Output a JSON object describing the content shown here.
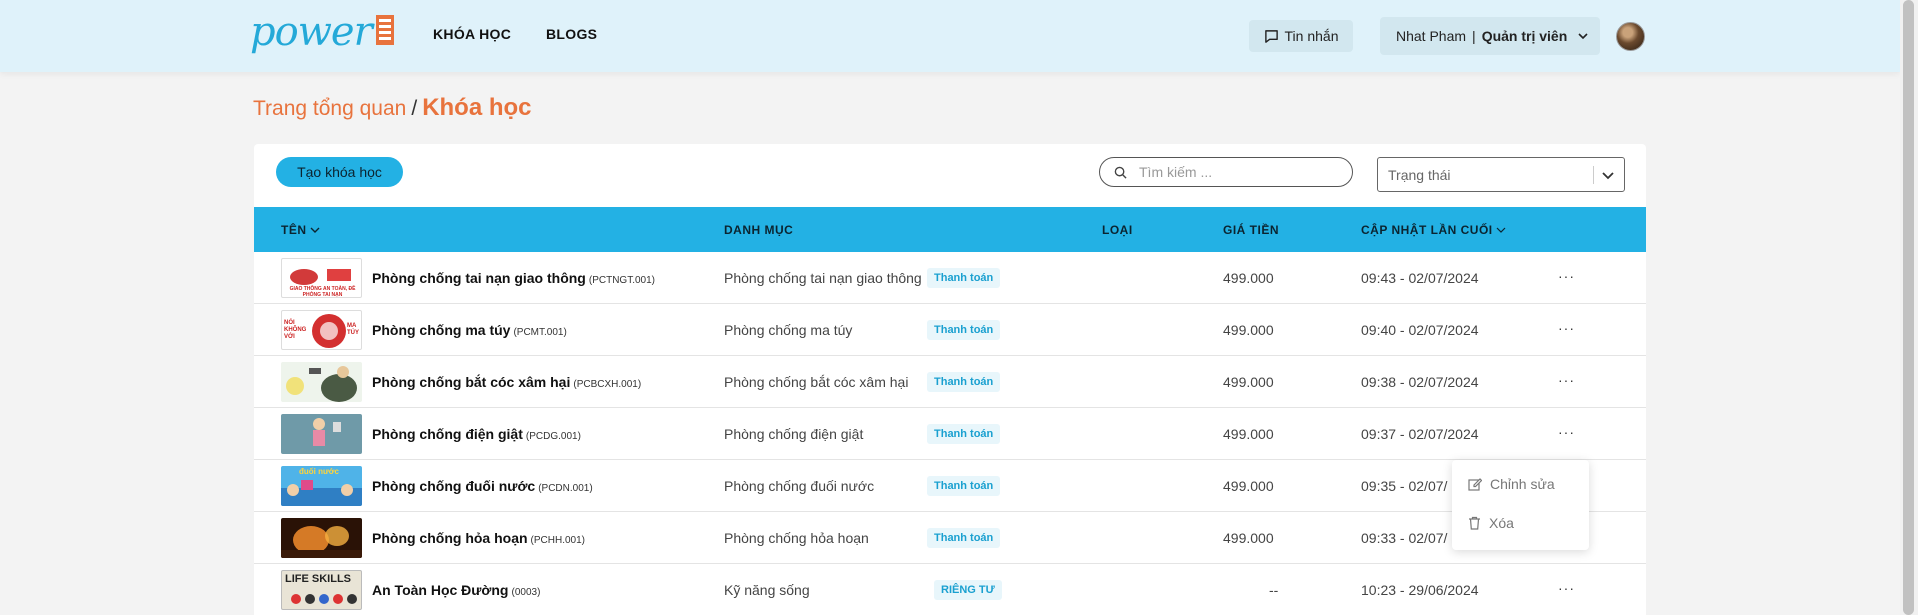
{
  "header": {
    "logo_text": "power",
    "nav": [
      "KHÓA HỌC",
      "BLOGS"
    ],
    "messages_label": "Tin nhắn",
    "user_name": "Nhat Pham",
    "user_sep": "|",
    "user_role": "Quản trị viên"
  },
  "breadcrumb": {
    "home": "Trang tổng quan",
    "sep": "/",
    "current": "Khóa học"
  },
  "toolbar": {
    "create_label": "Tạo khóa học",
    "search_placeholder": "Tìm kiếm ...",
    "status_placeholder": "Trạng thái"
  },
  "table": {
    "headers": {
      "name": "TÊN",
      "category": "DANH MỤC",
      "type": "LOẠI",
      "price": "GIÁ TIỀN",
      "updated": "CẬP NHẬT LẦN CUỐI"
    },
    "rows": [
      {
        "name": "Phòng chống tai nạn giao thông",
        "code": "(PCTNGT.001)",
        "category": "Phòng chống tai nạn giao thông",
        "type": "Thanh toán",
        "price": "499.000",
        "updated": "09:43 - 02/07/2024"
      },
      {
        "name": "Phòng chống ma túy",
        "code": "(PCMT.001)",
        "category": "Phòng chống ma túy",
        "type": "Thanh toán",
        "price": "499.000",
        "updated": "09:40 - 02/07/2024"
      },
      {
        "name": "Phòng chống bắt cóc xâm hại",
        "code": "(PCBCXH.001)",
        "category": "Phòng chống bắt cóc xâm hại",
        "type": "Thanh toán",
        "price": "499.000",
        "updated": "09:38 - 02/07/2024"
      },
      {
        "name": "Phòng chống điện giật",
        "code": "(PCDG.001)",
        "category": "Phòng chống điện giật",
        "type": "Thanh toán",
        "price": "499.000",
        "updated": "09:37 - 02/07/2024"
      },
      {
        "name": "Phòng chống đuối nước",
        "code": "(PCDN.001)",
        "category": "Phòng chống đuối nước",
        "type": "Thanh toán",
        "price": "499.000",
        "updated": "09:35 - 02/07/"
      },
      {
        "name": "Phòng chống hỏa hoạn",
        "code": "(PCHH.001)",
        "category": "Phòng chống hỏa hoạn",
        "type": "Thanh toán",
        "price": "499.000",
        "updated": "09:33 - 02/07/"
      },
      {
        "name": "An Toàn Học Đường",
        "code": "(0003)",
        "category": "Kỹ năng sống",
        "type": "RIÊNG TƯ",
        "price": "--",
        "updated": "10:23 - 29/06/2024"
      }
    ],
    "more": "···"
  },
  "thumbs": {
    "row0_caption": "GIAO THÔNG AN TOÀN, ĐỀ PHÒNG TAI NẠN",
    "row1_left": "NÓI KHÔNG VỚI",
    "row1_right": "MA TÚY",
    "row4_caption": "đuối nước",
    "row6_caption": "LIFE SKILLS"
  },
  "context_menu": {
    "edit": "Chỉnh sửa",
    "delete": "Xóa"
  },
  "colors": {
    "accent": "#23b1e4",
    "brand_orange": "#e8733d",
    "header_bg": "#dff2fa"
  }
}
